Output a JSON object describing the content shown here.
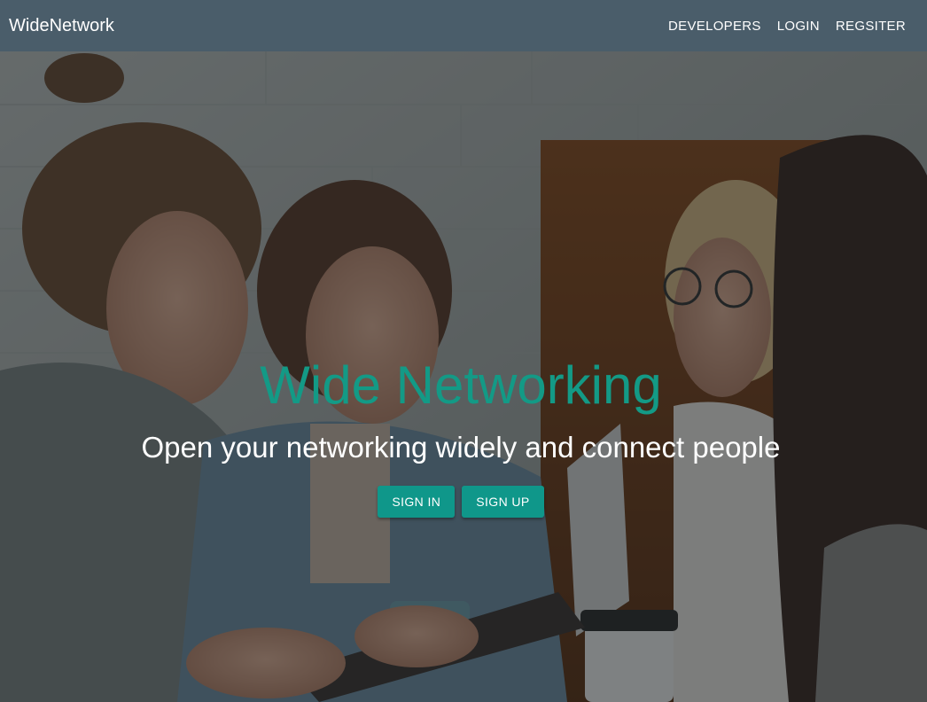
{
  "navbar": {
    "brand": "WideNetwork",
    "links": [
      "DEVELOPERS",
      "LOGIN",
      "REGSITER"
    ]
  },
  "hero": {
    "title": "Wide Networking",
    "subtitle": "Open your networking widely and connect people",
    "buttons": {
      "sign_in": "SIGN IN",
      "sign_up": "SIGN UP"
    }
  },
  "colors": {
    "navbar_bg": "#4a5d6a",
    "accent": "#139a86",
    "button_bg": "#0f978a"
  }
}
